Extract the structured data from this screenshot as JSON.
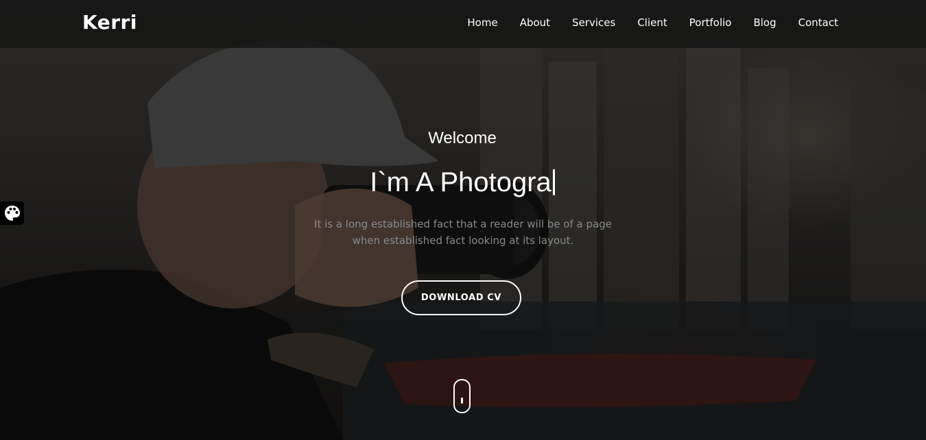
{
  "brand": {
    "logo_text": "Kerri"
  },
  "nav": {
    "items": [
      {
        "label": "Home"
      },
      {
        "label": "About"
      },
      {
        "label": "Services"
      },
      {
        "label": "Client"
      },
      {
        "label": "Portfolio"
      },
      {
        "label": "Blog"
      },
      {
        "label": "Contact"
      }
    ]
  },
  "hero": {
    "welcome": "Welcome",
    "headline": "I`m A Photogra",
    "description": "It is a long established fact that a reader will be of a page when established fact looking at its layout.",
    "cta_label": "DOWNLOAD CV"
  },
  "icons": {
    "palette": "palette-icon",
    "scroll": "scroll-mouse-icon"
  },
  "colors": {
    "navbar_bg": "#141414",
    "text_primary": "#ffffff",
    "text_muted": "#8a8a8a",
    "palette_toggle_bg": "#000000"
  }
}
